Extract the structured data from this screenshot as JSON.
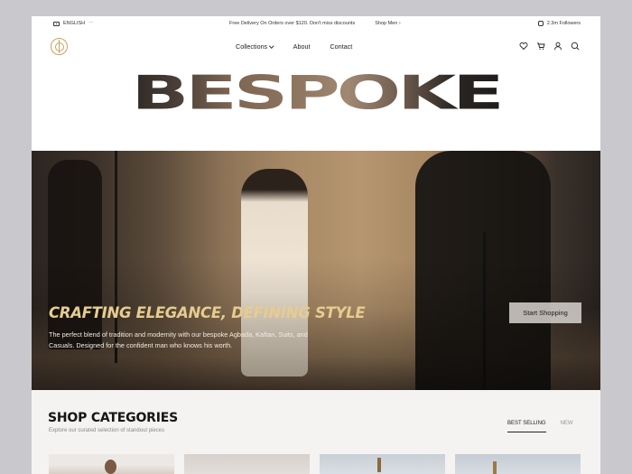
{
  "topbar": {
    "language": "ENGLISH",
    "promo": "Free Delivery On Orders over $120. Don't miss discounts",
    "shop_link": "Shop Men",
    "followers": "2.3m Followers"
  },
  "nav": {
    "items": [
      {
        "label": "Collections"
      },
      {
        "label": "About"
      },
      {
        "label": "Contact"
      }
    ]
  },
  "header_icons": [
    "heart-icon",
    "cart-icon",
    "user-icon",
    "search-icon"
  ],
  "brand": {
    "wordmark": "BESPOKE",
    "accent_color": "#c9a063"
  },
  "hero": {
    "title": "CRAFTING ELEGANCE, DEFINING STYLE",
    "description": "The perfect blend of tradition and modernity with our bespoke Agbada, Kaftan, Suits, and Casuals. Designed for the confident man who knows his worth.",
    "cta": "Start Shopping",
    "title_color": "#e6cc8f"
  },
  "categories": {
    "title": "SHOP CATEGORIES",
    "subtitle": "Explore our curated selection of standout pieces",
    "tabs": [
      {
        "label": "BEST SELLING",
        "active": true
      },
      {
        "label": "NEW",
        "active": false
      }
    ]
  }
}
